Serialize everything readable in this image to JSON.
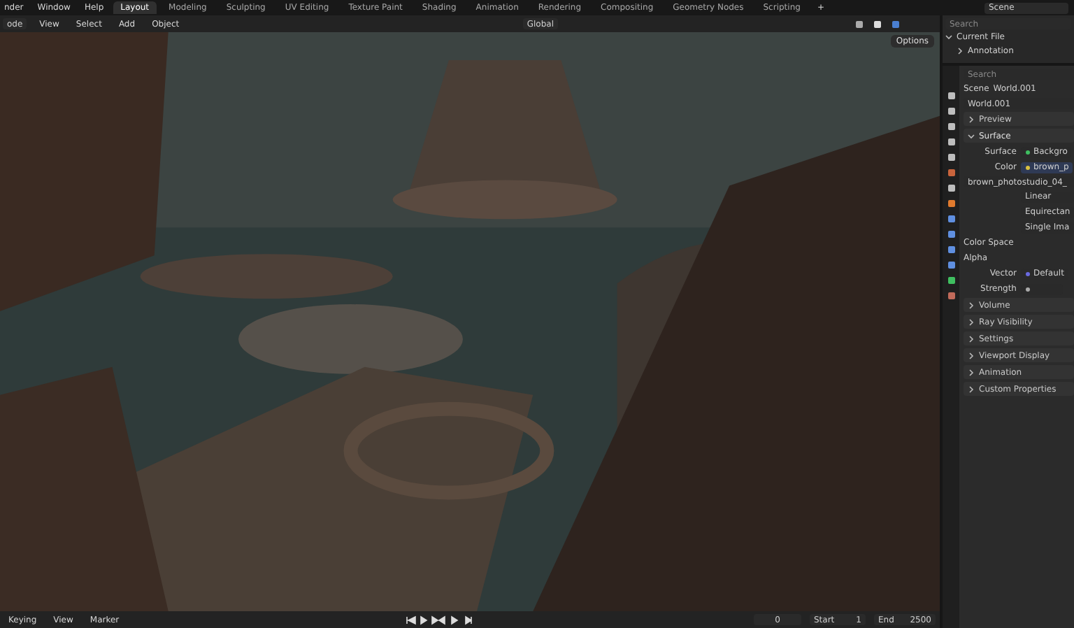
{
  "menu": [
    "nder",
    "Window",
    "Help"
  ],
  "workspaces": [
    {
      "label": "Layout",
      "selected": true
    },
    {
      "label": "Modeling",
      "selected": false
    },
    {
      "label": "Sculpting",
      "selected": false
    },
    {
      "label": "UV Editing",
      "selected": false
    },
    {
      "label": "Texture Paint",
      "selected": false
    },
    {
      "label": "Shading",
      "selected": false
    },
    {
      "label": "Animation",
      "selected": false
    },
    {
      "label": "Rendering",
      "selected": false
    },
    {
      "label": "Compositing",
      "selected": false
    },
    {
      "label": "Geometry Nodes",
      "selected": false
    },
    {
      "label": "Scripting",
      "selected": false
    }
  ],
  "add_workspace": "+",
  "scene": "Scene",
  "viewport_header": {
    "mode": "ode",
    "menus": [
      "View",
      "Select",
      "Add",
      "Object"
    ],
    "orientation": "Global",
    "options": "Options"
  },
  "outliner": {
    "search": {
      "placeholder": "Search"
    },
    "items": [
      {
        "label": "Current File",
        "expanded": true,
        "children": [
          {
            "label": "Annotation",
            "expanded": false
          }
        ]
      }
    ]
  },
  "properties": {
    "search": {
      "placeholder": "Search"
    },
    "breadcrumb": [
      "Scene",
      "World.001"
    ],
    "world": "World.001",
    "panels": [
      {
        "label": "Preview",
        "expanded": false
      },
      {
        "label": "Surface",
        "expanded": true
      }
    ],
    "surface": {
      "surface_label": "Surface",
      "surface_value": "Backgro",
      "color_label": "Color",
      "color_value": "brown_p",
      "image": "brown_photostudio_04_",
      "interpolation": "Linear",
      "projection": "Equirectan",
      "source": "Single Ima",
      "color_space_label": "Color Space",
      "alpha_label": "Alpha",
      "vector_label": "Vector",
      "vector_value": "Default",
      "strength_label": "Strength"
    },
    "sections": [
      {
        "label": "Volume",
        "expanded": false
      },
      {
        "label": "Ray Visibility",
        "expanded": false
      },
      {
        "label": "Settings",
        "expanded": false
      },
      {
        "label": "Viewport Display",
        "expanded": false
      },
      {
        "label": "Animation",
        "expanded": false
      },
      {
        "label": "Custom Properties",
        "expanded": false
      }
    ]
  },
  "timeline": {
    "menus": [
      "Keying",
      "View",
      "Marker"
    ],
    "current_frame": "0",
    "start_label": "Start",
    "start": "1",
    "end_label": "End",
    "end": "2500"
  }
}
